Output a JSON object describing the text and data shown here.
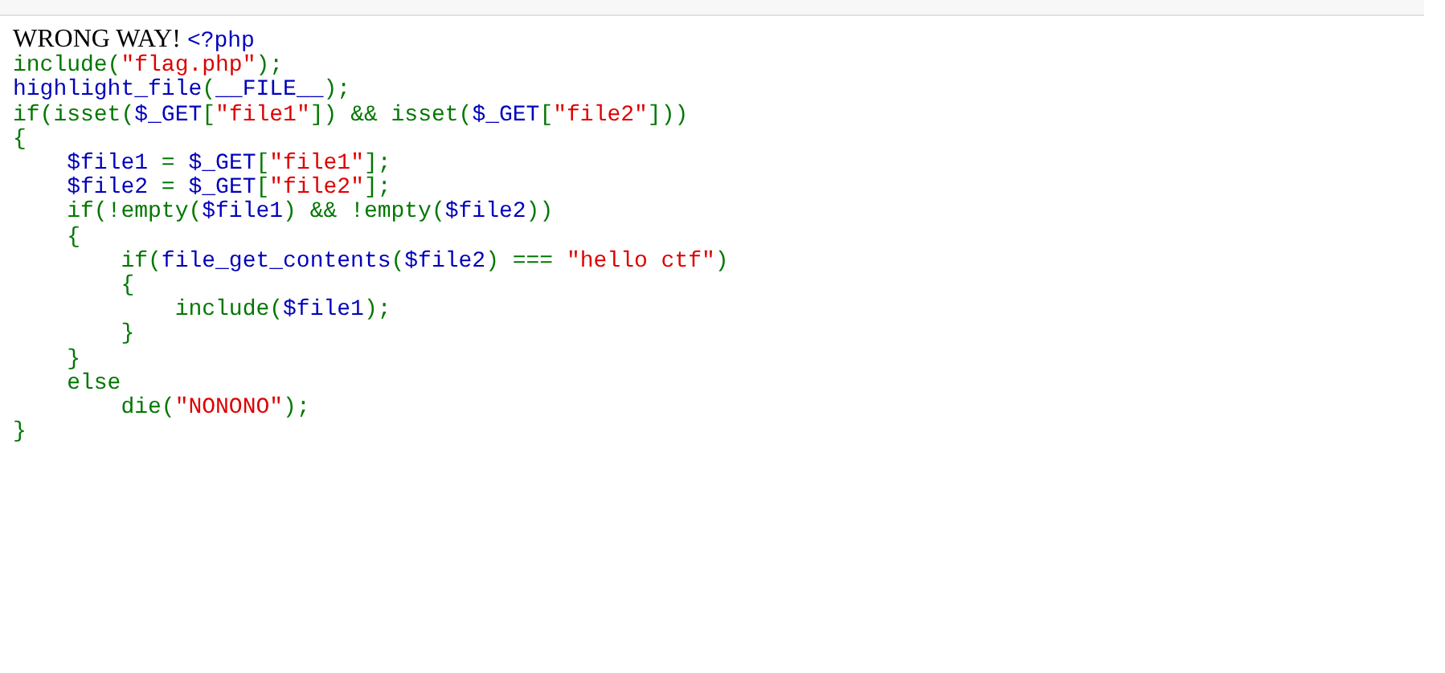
{
  "message": "WRONG WAY!",
  "code_lines": [
    {
      "tokens": [
        {
          "kind": "default",
          "text": "<?php"
        }
      ]
    },
    {
      "tokens": [
        {
          "kind": "keyword",
          "text": "include("
        },
        {
          "kind": "string",
          "text": "\"flag.php\""
        },
        {
          "kind": "keyword",
          "text": ");"
        }
      ]
    },
    {
      "tokens": [
        {
          "kind": "default",
          "text": "highlight_file"
        },
        {
          "kind": "keyword",
          "text": "("
        },
        {
          "kind": "default",
          "text": "__FILE__"
        },
        {
          "kind": "keyword",
          "text": ");"
        }
      ]
    },
    {
      "tokens": [
        {
          "kind": "keyword",
          "text": "if(isset("
        },
        {
          "kind": "default",
          "text": "$_GET"
        },
        {
          "kind": "keyword",
          "text": "["
        },
        {
          "kind": "string",
          "text": "\"file1\""
        },
        {
          "kind": "keyword",
          "text": "]) && isset("
        },
        {
          "kind": "default",
          "text": "$_GET"
        },
        {
          "kind": "keyword",
          "text": "["
        },
        {
          "kind": "string",
          "text": "\"file2\""
        },
        {
          "kind": "keyword",
          "text": "]))"
        }
      ]
    },
    {
      "tokens": [
        {
          "kind": "keyword",
          "text": "{"
        }
      ]
    },
    {
      "tokens": [
        {
          "kind": "default",
          "text": "    $file1 "
        },
        {
          "kind": "keyword",
          "text": "= "
        },
        {
          "kind": "default",
          "text": "$_GET"
        },
        {
          "kind": "keyword",
          "text": "["
        },
        {
          "kind": "string",
          "text": "\"file1\""
        },
        {
          "kind": "keyword",
          "text": "];"
        }
      ]
    },
    {
      "tokens": [
        {
          "kind": "default",
          "text": "    $file2 "
        },
        {
          "kind": "keyword",
          "text": "= "
        },
        {
          "kind": "default",
          "text": "$_GET"
        },
        {
          "kind": "keyword",
          "text": "["
        },
        {
          "kind": "string",
          "text": "\"file2\""
        },
        {
          "kind": "keyword",
          "text": "];"
        }
      ]
    },
    {
      "tokens": [
        {
          "kind": "keyword",
          "text": "    if(!empty("
        },
        {
          "kind": "default",
          "text": "$file1"
        },
        {
          "kind": "keyword",
          "text": ") && !empty("
        },
        {
          "kind": "default",
          "text": "$file2"
        },
        {
          "kind": "keyword",
          "text": "))"
        }
      ]
    },
    {
      "tokens": [
        {
          "kind": "keyword",
          "text": "    {"
        }
      ]
    },
    {
      "tokens": [
        {
          "kind": "keyword",
          "text": "        if("
        },
        {
          "kind": "default",
          "text": "file_get_contents"
        },
        {
          "kind": "keyword",
          "text": "("
        },
        {
          "kind": "default",
          "text": "$file2"
        },
        {
          "kind": "keyword",
          "text": ") === "
        },
        {
          "kind": "string",
          "text": "\"hello ctf\""
        },
        {
          "kind": "keyword",
          "text": ")"
        }
      ]
    },
    {
      "tokens": [
        {
          "kind": "keyword",
          "text": "        {"
        }
      ]
    },
    {
      "tokens": [
        {
          "kind": "keyword",
          "text": "            include("
        },
        {
          "kind": "default",
          "text": "$file1"
        },
        {
          "kind": "keyword",
          "text": ");"
        }
      ]
    },
    {
      "tokens": [
        {
          "kind": "keyword",
          "text": "        }"
        }
      ]
    },
    {
      "tokens": [
        {
          "kind": "keyword",
          "text": "    }"
        }
      ]
    },
    {
      "tokens": [
        {
          "kind": "keyword",
          "text": "    else"
        }
      ]
    },
    {
      "tokens": [
        {
          "kind": "keyword",
          "text": "        die("
        },
        {
          "kind": "string",
          "text": "\"NONONO\""
        },
        {
          "kind": "keyword",
          "text": ");"
        }
      ]
    },
    {
      "tokens": [
        {
          "kind": "keyword",
          "text": "}"
        }
      ]
    }
  ]
}
